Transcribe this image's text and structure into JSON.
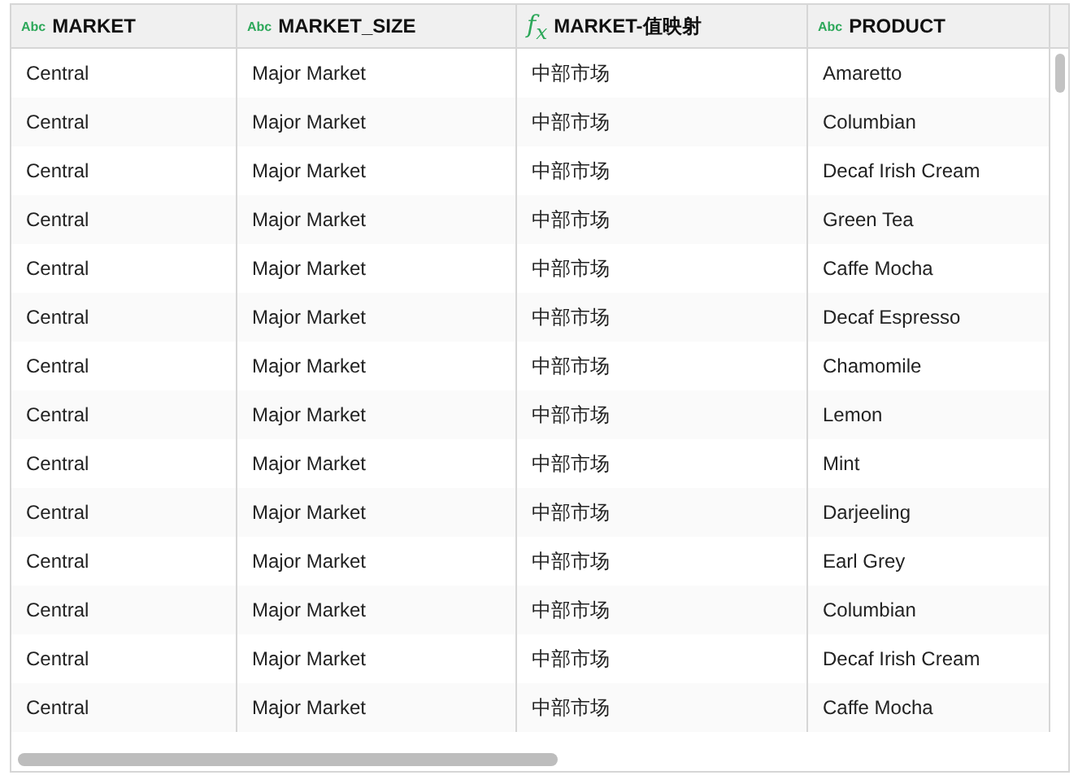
{
  "table": {
    "columns": [
      {
        "label": "MARKET",
        "kind": "text",
        "type_icon": "Abc"
      },
      {
        "label": "MARKET_SIZE",
        "kind": "text",
        "type_icon": "Abc"
      },
      {
        "label": "MARKET-值映射",
        "kind": "formula",
        "type_icon": "f$_{x}$"
      },
      {
        "label": "PRODUCT",
        "kind": "text",
        "type_icon": "Abc"
      }
    ],
    "rows": [
      [
        "Central",
        "Major Market",
        "中部市场",
        "Amaretto"
      ],
      [
        "Central",
        "Major Market",
        "中部市场",
        "Columbian"
      ],
      [
        "Central",
        "Major Market",
        "中部市场",
        "Decaf Irish Cream"
      ],
      [
        "Central",
        "Major Market",
        "中部市场",
        "Green Tea"
      ],
      [
        "Central",
        "Major Market",
        "中部市场",
        "Caffe Mocha"
      ],
      [
        "Central",
        "Major Market",
        "中部市场",
        "Decaf Espresso"
      ],
      [
        "Central",
        "Major Market",
        "中部市场",
        "Chamomile"
      ],
      [
        "Central",
        "Major Market",
        "中部市场",
        "Lemon"
      ],
      [
        "Central",
        "Major Market",
        "中部市场",
        "Mint"
      ],
      [
        "Central",
        "Major Market",
        "中部市场",
        "Darjeeling"
      ],
      [
        "Central",
        "Major Market",
        "中部市场",
        "Earl Grey"
      ],
      [
        "Central",
        "Major Market",
        "中部市场",
        "Columbian"
      ],
      [
        "Central",
        "Major Market",
        "中部市场",
        "Decaf Irish Cream"
      ],
      [
        "Central",
        "Major Market",
        "中部市场",
        "Caffe Mocha"
      ]
    ]
  }
}
